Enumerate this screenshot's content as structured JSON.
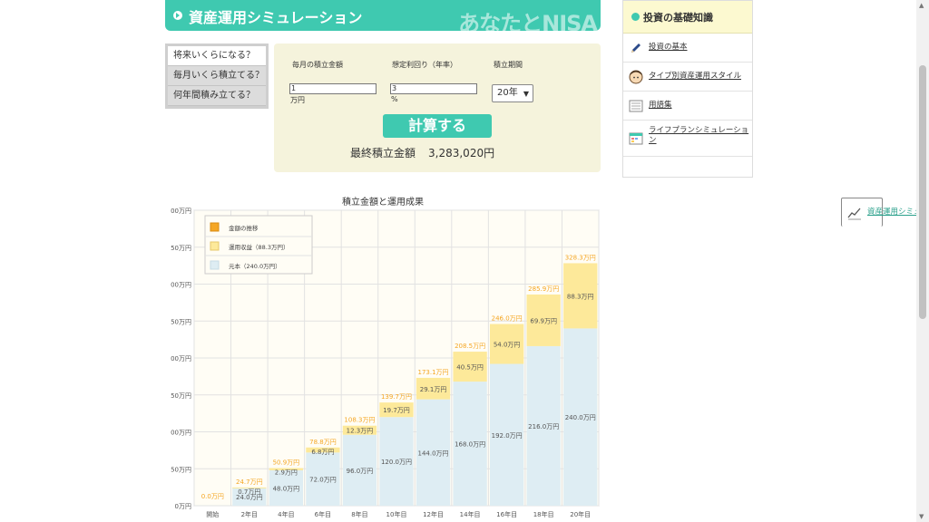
{
  "header": {
    "title": "資産運用シミュレーション",
    "brand": "あなたとNISA"
  },
  "tabs": [
    {
      "label": "将来いくらになる？",
      "active": true
    },
    {
      "label": "毎月いくら積立てる？",
      "active": false
    },
    {
      "label": "何年間積み立てる？",
      "active": false
    }
  ],
  "form": {
    "monthly": {
      "label": "毎月の積立金額",
      "value": "1",
      "unit": "万円"
    },
    "rate": {
      "label": "想定利回り（年率）",
      "value": "3",
      "unit": "%"
    },
    "period": {
      "label": "積立期間",
      "value": "20年"
    },
    "calc_label": "計算する",
    "result_label": "最終積立金額",
    "result_value": "3,283,020円"
  },
  "sidebar": {
    "title": "投資の基礎知識",
    "items": [
      {
        "label": "投資の基本",
        "icon": "pencil-icon"
      },
      {
        "label": "タイプ別資産運用スタイル",
        "icon": "person-icon"
      },
      {
        "label": "用語集",
        "icon": "book-icon"
      },
      {
        "label": "ライフプランシミュレーション",
        "icon": "calendar-icon"
      },
      {
        "label": "資産運用シミュレーション",
        "icon": "chart-icon"
      }
    ]
  },
  "colors": {
    "accent": "#3fc9b0",
    "principal": "#deedf3",
    "profit": "#fde99a",
    "total_label": "#f5a623",
    "panel": "#f5f3dc",
    "chart_bg": "#fffdf5"
  },
  "chart_data": {
    "type": "bar",
    "title": "積立金額と運用成果",
    "stacked": true,
    "unit": "万円",
    "categories": [
      "開始",
      "2年目",
      "4年目",
      "6年目",
      "8年目",
      "10年目",
      "12年目",
      "14年目",
      "16年目",
      "18年目",
      "20年目"
    ],
    "series": [
      {
        "name": "元本（240.0万円）",
        "values": [
          0,
          24.0,
          48.0,
          72.0,
          96.0,
          120.0,
          144.0,
          168.0,
          192.0,
          216.0,
          240.0
        ]
      },
      {
        "name": "運用収益（88.3万円）",
        "values": [
          0,
          0.7,
          2.9,
          6.8,
          12.3,
          19.7,
          29.1,
          40.5,
          54.0,
          69.9,
          88.3
        ]
      }
    ],
    "totals": [
      0.0,
      24.7,
      50.9,
      78.8,
      108.3,
      139.7,
      173.1,
      208.5,
      246.0,
      285.9,
      328.3
    ],
    "value_labels": {
      "principal": [
        "",
        "24.0万円",
        "48.0万円",
        "72.0万円",
        "96.0万円",
        "120.0万円",
        "144.0万円",
        "168.0万円",
        "192.0万円",
        "216.0万円",
        "240.0万円"
      ],
      "profit": [
        "",
        "0.7万円",
        "2.9万円",
        "6.8万円",
        "12.3万円",
        "19.7万円",
        "29.1万円",
        "40.5万円",
        "54.0万円",
        "69.9万円",
        "88.3万円"
      ],
      "total": [
        "0.0万円",
        "24.7万円",
        "50.9万円",
        "78.8万円",
        "108.3万円",
        "139.7万円",
        "173.1万円",
        "208.5万円",
        "246.0万円",
        "285.9万円",
        "328.3万円"
      ]
    },
    "legend": [
      "金額の推移",
      "運用収益（88.3万円）",
      "元本（240.0万円）"
    ],
    "legend_position": "top-left",
    "y_tick_labels": [
      "0万円",
      "50万円",
      "00万円",
      "50万円",
      "00万円",
      "50万円",
      "00万円",
      "50万円",
      "00万円"
    ],
    "ylim": [
      0,
      400
    ],
    "grid": true
  }
}
